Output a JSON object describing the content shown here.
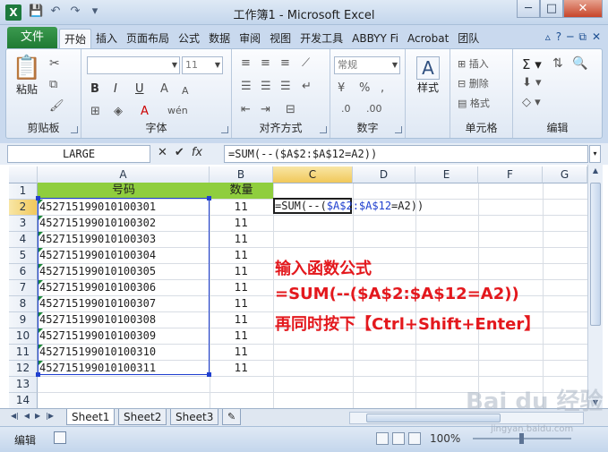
{
  "window": {
    "title": "工作簿1 - Microsoft Excel",
    "app_logo": "X",
    "minimize": "─",
    "maximize": "□",
    "close": "✕"
  },
  "ribbon_tabs": {
    "file": "文件",
    "tabs": [
      "开始",
      "插入",
      "页面布局",
      "公式",
      "数据",
      "审阅",
      "视图",
      "开发工具",
      "ABBYY Fi",
      "Acrobat",
      "团队"
    ]
  },
  "ribbon": {
    "clipboard": {
      "label": "剪贴板",
      "paste": "粘贴"
    },
    "font": {
      "label": "字体",
      "font_size": "11",
      "bold": "B",
      "italic": "I",
      "underline": "U"
    },
    "alignment": {
      "label": "对齐方式"
    },
    "number": {
      "label": "数字",
      "format": "常规"
    },
    "styles": {
      "label": "样式"
    },
    "cells": {
      "label": "单元格",
      "insert": "插入",
      "delete": "删除",
      "format": "格式"
    },
    "editing": {
      "label": "编辑"
    }
  },
  "formula_bar": {
    "name_box": "LARGE",
    "cancel": "✕",
    "enter": "✔",
    "fx": "fx",
    "formula": "=SUM(--($A$2:$A$12=A2))"
  },
  "columns": [
    "A",
    "B",
    "C",
    "D",
    "E",
    "F",
    "G"
  ],
  "rows": [
    "1",
    "2",
    "3",
    "4",
    "5",
    "6",
    "7",
    "8",
    "9",
    "10",
    "11",
    "12",
    "13",
    "14"
  ],
  "sheet": {
    "header_a": "号码",
    "header_b": "数量",
    "col_a": [
      "452715199010100301",
      "452715199010100302",
      "452715199010100303",
      "452715199010100304",
      "452715199010100305",
      "452715199010100306",
      "452715199010100307",
      "452715199010100308",
      "452715199010100309",
      "452715199010100310",
      "452715199010100311"
    ],
    "col_b": [
      "11",
      "11",
      "11",
      "11",
      "11",
      "11",
      "11",
      "11",
      "11",
      "11",
      "11"
    ],
    "editing_prefix": "=SUM(--(",
    "editing_ref": "$A$2:$A$12",
    "editing_suffix": "=A2))"
  },
  "annotation": {
    "line1": "输入函数公式",
    "line2": "=SUM(--($A$2:$A$12=A2))",
    "line3": "再同时按下【Ctrl+Shift+Enter】",
    "color": "#e3181d"
  },
  "sheet_tabs": [
    "Sheet1",
    "Sheet2",
    "Sheet3"
  ],
  "status": {
    "mode": "编辑",
    "zoom": "100%"
  },
  "watermark": {
    "brand": "Bai du 经验",
    "url": "jingyan.baidu.com"
  },
  "colors": {
    "header_fill": "#8fce3e",
    "range_border": "#1f3fcf",
    "file_tab": "#1f7a33"
  }
}
